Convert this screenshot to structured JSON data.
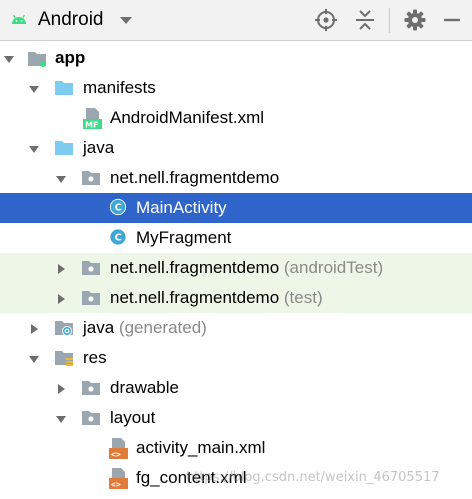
{
  "toolbar": {
    "view_mode": "Android",
    "icons": [
      "android-icon",
      "chevron-down-icon",
      "locate-icon",
      "collapse-all-icon",
      "gear-icon",
      "hide-icon"
    ]
  },
  "tree": {
    "app": "app",
    "manifests": "manifests",
    "android_manifest": "AndroidManifest.xml",
    "java": "java",
    "pkg_main": "net.nell.fragmentdemo",
    "main_activity": "MainActivity",
    "my_fragment": "MyFragment",
    "pkg_android_test": "net.nell.fragmentdemo",
    "pkg_android_test_suffix": "(androidTest)",
    "pkg_test": "net.nell.fragmentdemo",
    "pkg_test_suffix": "(test)",
    "java_generated": "java",
    "java_generated_suffix": "(generated)",
    "res": "res",
    "drawable": "drawable",
    "layout": "layout",
    "activity_main": "activity_main.xml",
    "fg_content": "fg_content.xml"
  },
  "watermark": "https://blog.csdn.net/weixin_46705517",
  "colors": {
    "selection": "#2f65ca",
    "test_tint": "#eef6e7",
    "folder": "#7ecdf0",
    "package": "#9aa7b0",
    "class_icon": "#3fa7d8",
    "android_green": "#3ddc84",
    "xml_orange": "#e07b39"
  }
}
